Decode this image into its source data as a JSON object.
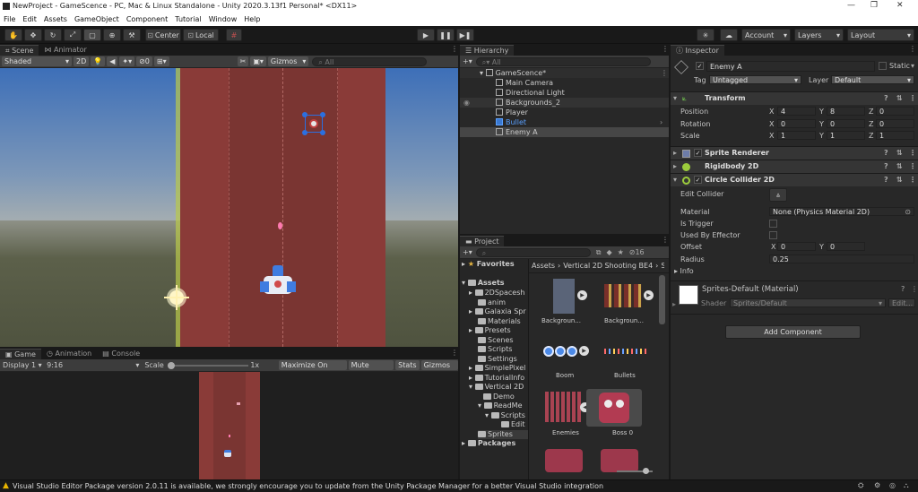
{
  "window": {
    "title": "NewProject - GameScence - PC, Mac & Linux Standalone - Unity 2020.3.13f1 Personal* <DX11>"
  },
  "menu": [
    "File",
    "Edit",
    "Assets",
    "GameObject",
    "Component",
    "Tutorial",
    "Window",
    "Help"
  ],
  "toolbar": {
    "center": "Center",
    "local": "Local",
    "account": "Account",
    "layers": "Layers",
    "layout": "Layout"
  },
  "scene": {
    "tab": "Scene",
    "tab2": "Animator",
    "shading": "Shaded",
    "mode2d": "2D",
    "gizmos": "Gizmos",
    "search_placeholder": "All",
    "hidden_count": "0"
  },
  "game": {
    "tab": "Game",
    "tab2": "Animation",
    "tab3": "Console",
    "display": "Display 1",
    "aspect": "9:16",
    "scale_label": "Scale",
    "scale_value": "1x",
    "maximize": "Maximize On Play",
    "mute": "Mute Audio",
    "stats": "Stats",
    "gizmos": "Gizmos"
  },
  "hierarchy": {
    "tab": "Hierarchy",
    "search_placeholder": "All",
    "scene": "GameScence*",
    "items": [
      "Main Camera",
      "Directional Light",
      "Backgrounds_2",
      "Player",
      "Bullet",
      "Enemy A"
    ]
  },
  "project": {
    "tab": "Project",
    "hidden_count": "16",
    "favorites": "Favorites",
    "assets": "Assets",
    "packages": "Packages",
    "tree": [
      "2DSpacesh",
      "anim",
      "Galaxia Spr",
      "Materials",
      "Presets",
      "Scenes",
      "Scripts",
      "Settings",
      "SimplePixel",
      "TutorialInfo",
      "Vertical 2D",
      "Demo",
      "ReadMe",
      "Scripts",
      "Edit",
      "Sprites"
    ],
    "breadcrumb": [
      "Assets",
      "Vertical 2D Shooting BE4",
      "S"
    ],
    "grid": [
      "Backgroun...",
      "Backgroun...",
      "Boom",
      "Bullets",
      "Enemies",
      "Boss 0"
    ]
  },
  "inspector": {
    "tab": "Inspector",
    "object_name": "Enemy A",
    "static_label": "Static",
    "tag_label": "Tag",
    "tag_value": "Untagged",
    "layer_label": "Layer",
    "layer_value": "Default",
    "transform": {
      "title": "Transform",
      "position_label": "Position",
      "rotation_label": "Rotation",
      "scale_label": "Scale",
      "axes": [
        "X",
        "Y",
        "Z"
      ],
      "position": [
        "4",
        "8",
        "0"
      ],
      "rotation": [
        "0",
        "0",
        "0"
      ],
      "scale": [
        "1",
        "1",
        "1"
      ]
    },
    "components": [
      "Sprite Renderer",
      "Rigidbody 2D",
      "Circle Collider 2D"
    ],
    "collider": {
      "edit_label": "Edit Collider",
      "material_label": "Material",
      "material_value": "None (Physics Material 2D)",
      "trigger_label": "Is Trigger",
      "effector_label": "Used By Effector",
      "offset_label": "Offset",
      "offset_x_axis": "X",
      "offset_x": "0",
      "offset_y_axis": "Y",
      "offset_y": "0",
      "radius_label": "Radius",
      "radius_value": "0.25"
    },
    "material": {
      "name": "Sprites-Default (Material)",
      "shader_label": "Shader",
      "shader_value": "Sprites/Default",
      "edit": "Edit..."
    },
    "add_component": "Add Component"
  },
  "status": {
    "message": "Visual Studio Editor Package version 2.0.11 is available, we strongly encourage you to update from the Unity Package Manager for a better Visual Studio integration"
  },
  "colors": {
    "road": "#8a3b38",
    "road_edge": "#7a302c",
    "sky_top": "#3d6fb8",
    "sky_bottom": "#9aa5a9",
    "ground": "#5a5e47",
    "panel": "#282828",
    "accent": "#3a78d0",
    "warning": "#e8b400"
  }
}
